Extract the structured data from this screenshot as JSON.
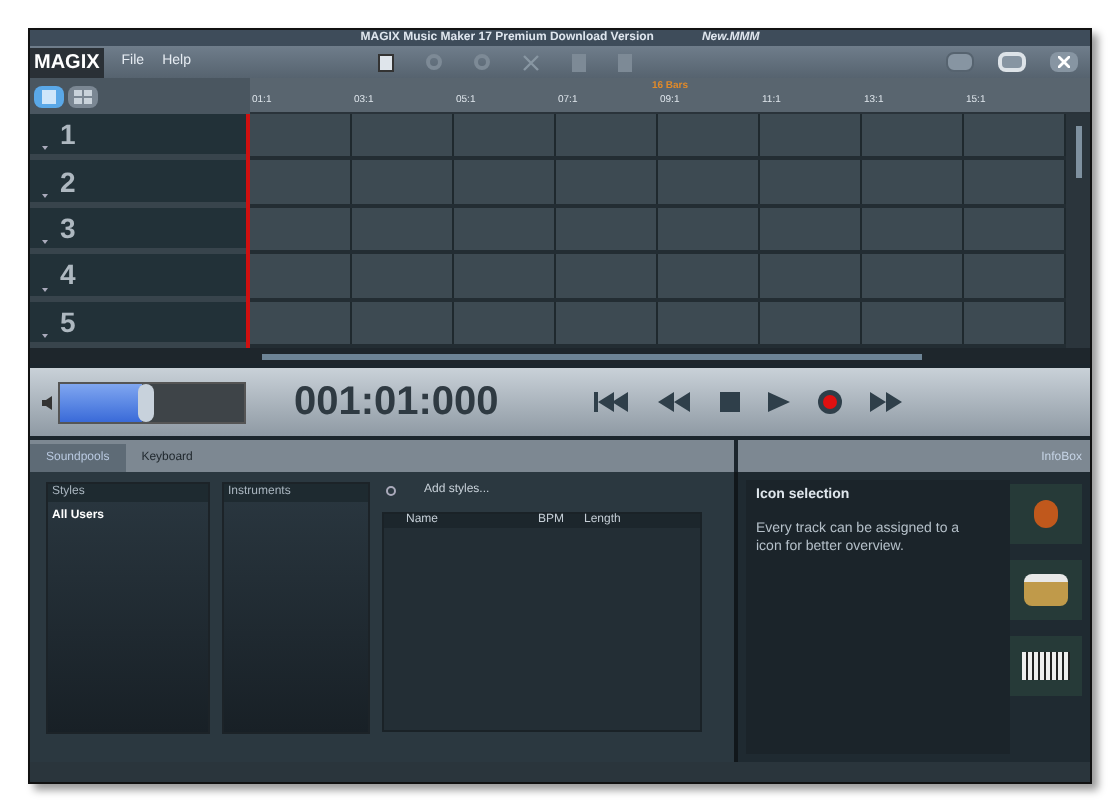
{
  "window": {
    "title": "MAGIX Music Maker 17 Premium Download Version",
    "project": "New.MMM"
  },
  "logo": "MAGIX",
  "menu": [
    "File",
    "Help"
  ],
  "view_toggles": [
    {
      "kind": "tracks",
      "selected": true
    },
    {
      "kind": "grid",
      "selected": false
    }
  ],
  "ruler": {
    "range_label": "16 Bars",
    "marks": [
      "01:1",
      "03:1",
      "05:1",
      "07:1",
      "09:1",
      "11:1",
      "13:1",
      "15:1"
    ]
  },
  "tracks": [
    {
      "number": "1"
    },
    {
      "number": "2"
    },
    {
      "number": "3"
    },
    {
      "number": "4"
    },
    {
      "number": "5"
    }
  ],
  "transport": {
    "position": {
      "level": 0.45
    },
    "time": "001:01:000"
  },
  "tabs": [
    {
      "label": "Soundpools",
      "selected": true
    },
    {
      "label": "Keyboard",
      "selected": false
    }
  ],
  "infobox_tab": "InfoBox",
  "styles": {
    "header": "Styles",
    "items": [
      "All Users"
    ]
  },
  "instruments": {
    "header": "Instruments"
  },
  "add_styles": "Add styles...",
  "table": {
    "columns": [
      "Name",
      "BPM",
      "Length"
    ]
  },
  "info": {
    "title": "Icon selection",
    "text": "Every track can be assigned to a icon for better overview."
  }
}
